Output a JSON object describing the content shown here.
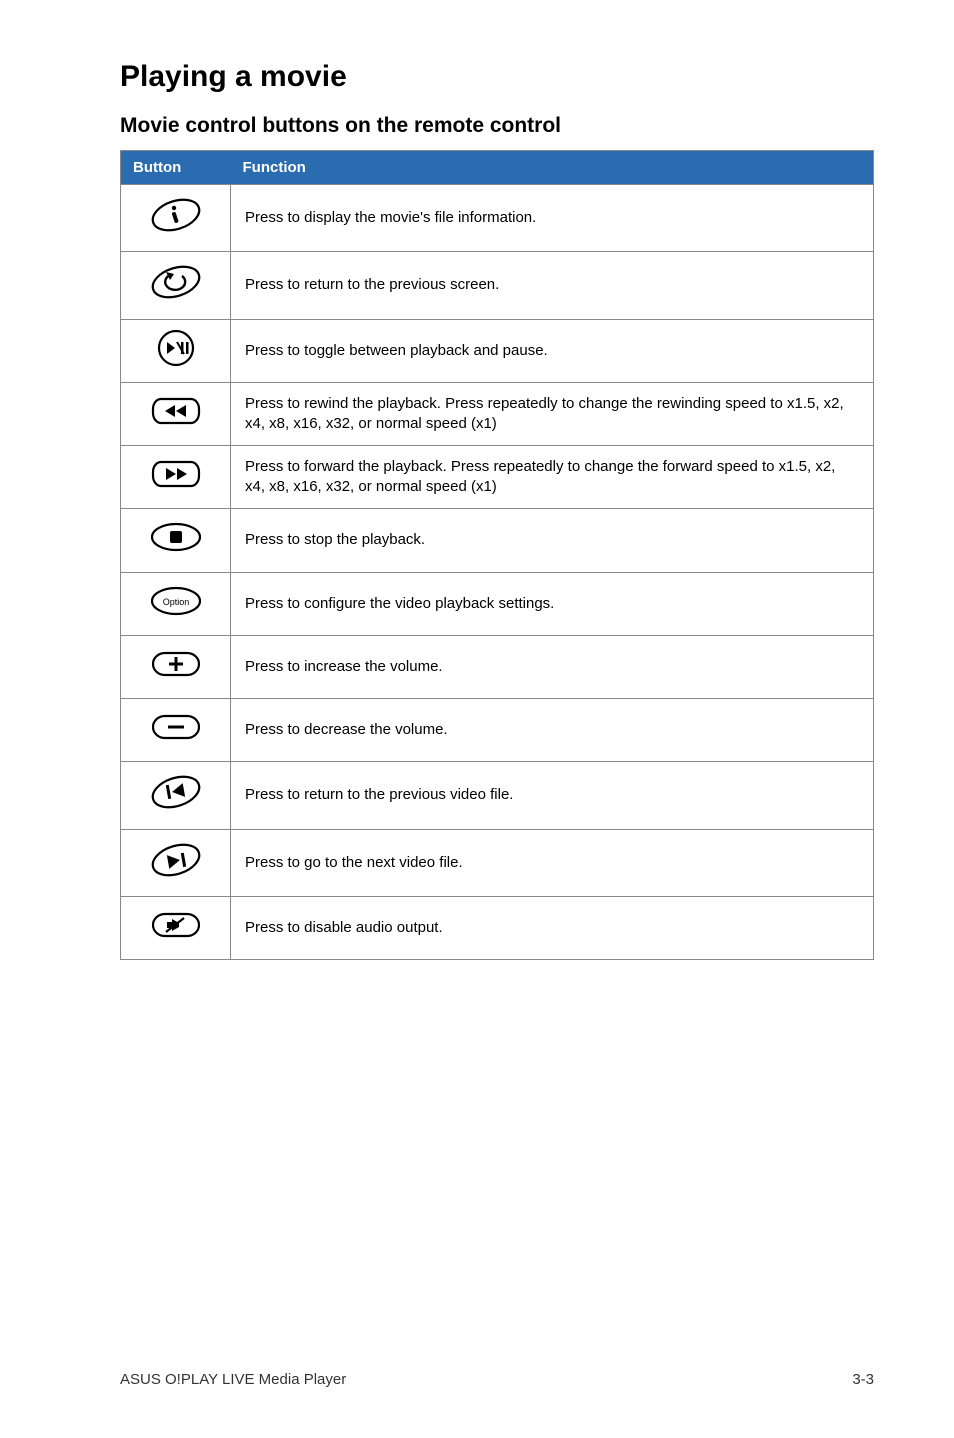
{
  "heading": "Playing a movie",
  "subheading": "Movie control buttons on the remote control",
  "table": {
    "header_button": "Button",
    "header_function": "Function",
    "rows": [
      {
        "icon": "info-icon",
        "desc": "Press to display the movie's file information."
      },
      {
        "icon": "return-icon",
        "desc": "Press to return to the previous screen."
      },
      {
        "icon": "play-pause-icon",
        "desc": "Press to toggle between playback and pause."
      },
      {
        "icon": "rewind-icon",
        "desc": "Press to rewind the playback. Press repeatedly to change the rewinding speed to x1.5, x2, x4, x8, x16, x32, or normal speed (x1)"
      },
      {
        "icon": "forward-icon",
        "desc": "Press to forward the playback. Press repeatedly to change the forward speed to x1.5, x2, x4, x8, x16, x32, or normal speed (x1)"
      },
      {
        "icon": "stop-icon",
        "desc": "Press to stop the playback."
      },
      {
        "icon": "option-icon",
        "desc": "Press to configure the video playback settings."
      },
      {
        "icon": "vol-up-icon",
        "desc": "Press to increase the volume."
      },
      {
        "icon": "vol-down-icon",
        "desc": "Press to decrease the volume."
      },
      {
        "icon": "prev-file-icon",
        "desc": "Press to return to the previous video file."
      },
      {
        "icon": "next-file-icon",
        "desc": "Press to go to the next video file."
      },
      {
        "icon": "mute-icon",
        "desc": "Press to disable audio output."
      }
    ]
  },
  "footer_left": "ASUS O!PLAY LIVE Media Player",
  "footer_right": "3-3"
}
